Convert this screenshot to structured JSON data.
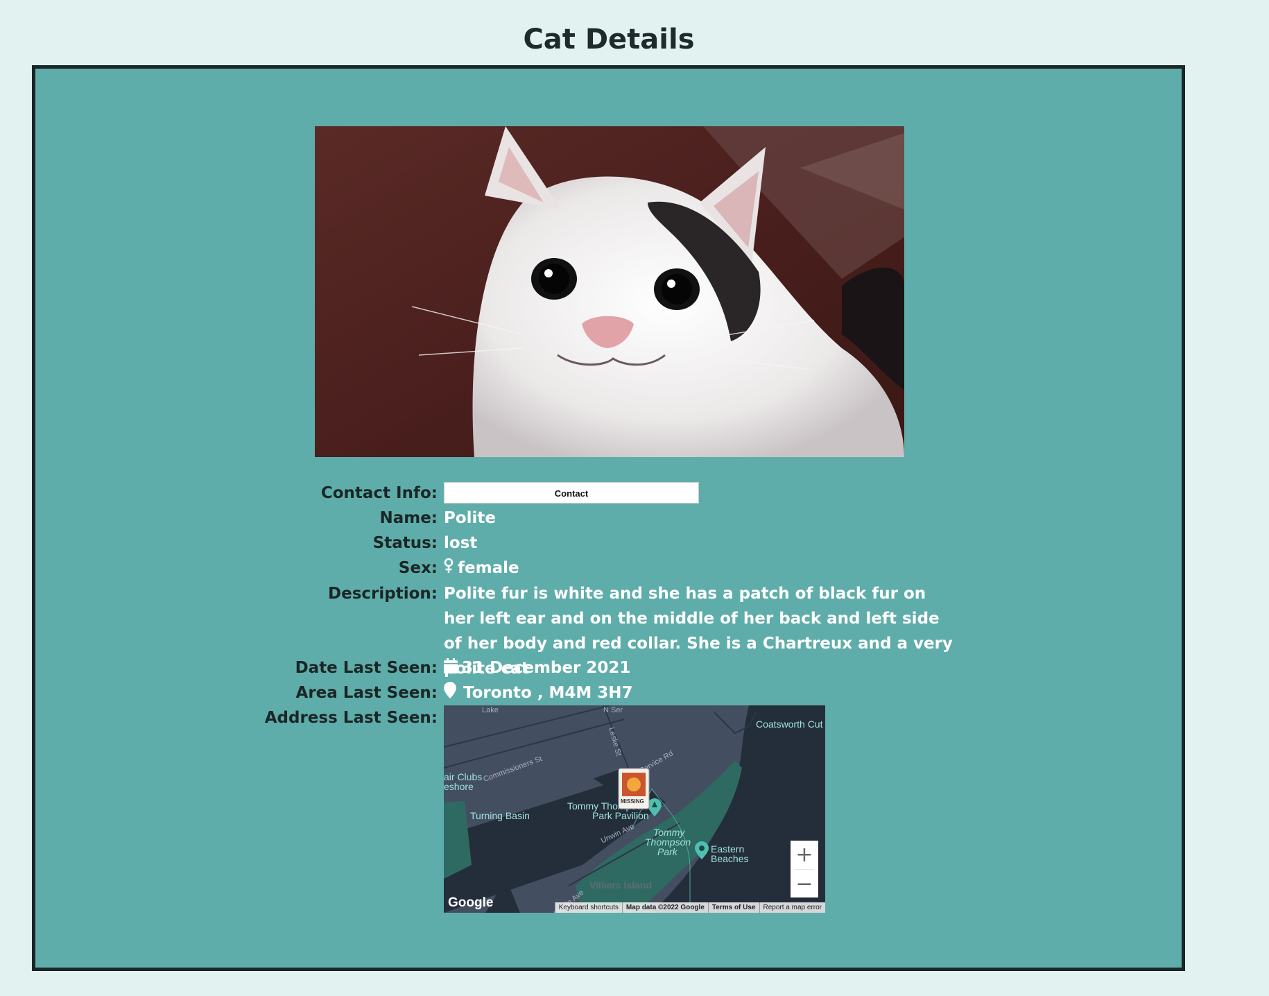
{
  "page": {
    "title": "Cat Details"
  },
  "details": {
    "contact_label": "Contact Info:",
    "contact_button": "Contact",
    "name_label": "Name:",
    "name": "Polite",
    "status_label": "Status:",
    "status": "lost",
    "sex_label": "Sex:",
    "sex": "female",
    "sex_icon": "female-icon",
    "description_label": "Description:",
    "description": "Polite fur is white and she has a patch of black fur on her left ear and on the middle of her back and left side of her body and red collar. She is a Chartreux and a very polite cat",
    "date_label": "Date Last Seen:",
    "date": "31 December 2021",
    "date_icon": "calendar-icon",
    "area_label": "Area Last Seen:",
    "area": "Toronto , M4M 3H7",
    "area_icon": "map-pin-icon",
    "address_label": "Address Last Seen:"
  },
  "map": {
    "labels": {
      "coatsworth": "Coatsworth Cut",
      "commissioners": "Commissioners St",
      "clubs": "air Clubs",
      "eshore": "eshore",
      "turning_basin": "Turning Basin",
      "pavilion_1": "Tommy Thompson",
      "pavilion_2": "Park Pavilion",
      "park_1": "Tommy",
      "park_2": "Thompson",
      "park_3": "Park",
      "beaches_1": "Eastern",
      "beaches_2": "Beaches",
      "service_rd": "Service Rd",
      "leslie": "Leslie St",
      "unwin": "Unwin Ave",
      "lake": "Lake",
      "n_service": "N Ser",
      "villiers": "Villiers Island",
      "unwin2": "Unwin Ave"
    },
    "marker_text": "MISSING",
    "zoom_in": "+",
    "zoom_out": "−",
    "logo": "Google",
    "attribution": {
      "shortcuts": "Keyboard shortcuts",
      "data": "Map data ©2022 Google",
      "terms": "Terms of Use",
      "report": "Report a map error"
    }
  },
  "colors": {
    "background": "#e1f2f1",
    "card": "#5fadaa",
    "border": "#1b2626",
    "map_land": "#434f61",
    "map_water": "#242e3a",
    "map_park": "#2f6a62"
  }
}
